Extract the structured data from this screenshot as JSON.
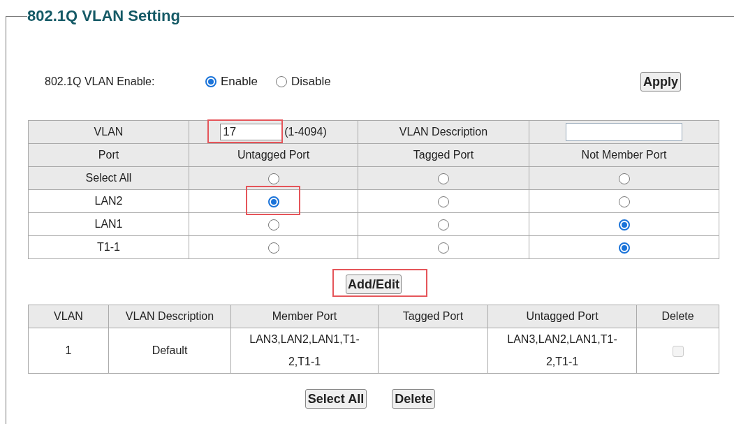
{
  "title": "802.1Q VLAN Setting",
  "enable": {
    "label": "802.1Q VLAN Enable:",
    "options": [
      {
        "label": "Enable",
        "selected": true
      },
      {
        "label": "Disable",
        "selected": false
      }
    ],
    "apply": "Apply"
  },
  "editor": {
    "vlan_label": "VLAN",
    "vlan_value": "17",
    "vlan_highlighted": true,
    "vlan_range": "(1-4094)",
    "description_label": "VLAN Description",
    "columns": [
      "Port",
      "Untagged Port",
      "Tagged Port",
      "Not Member Port"
    ],
    "rows": [
      {
        "port": "Select All",
        "options": [
          {
            "selected": false,
            "highlighted": false
          },
          {
            "selected": false,
            "highlighted": false
          },
          {
            "selected": false,
            "highlighted": false
          }
        ]
      },
      {
        "port": "LAN2",
        "options": [
          {
            "selected": true,
            "highlighted": true
          },
          {
            "selected": false,
            "highlighted": false
          },
          {
            "selected": false,
            "highlighted": false
          }
        ]
      },
      {
        "port": "LAN1",
        "options": [
          {
            "selected": false,
            "highlighted": false
          },
          {
            "selected": false,
            "highlighted": false
          },
          {
            "selected": true,
            "highlighted": false
          }
        ]
      },
      {
        "port": "T1-1",
        "options": [
          {
            "selected": false,
            "highlighted": false
          },
          {
            "selected": false,
            "highlighted": false
          },
          {
            "selected": true,
            "highlighted": false
          }
        ]
      }
    ],
    "add_edit": "Add/Edit",
    "add_edit_highlighted": true
  },
  "table": {
    "columns": [
      "VLAN",
      "VLAN Description",
      "Member Port",
      "Tagged Port",
      "Untagged Port",
      "Delete"
    ],
    "rows": [
      {
        "vlan": "1",
        "description": "Default",
        "member_ports": "LAN3,LAN2,LAN1,T1-2,T1-1",
        "tagged_ports": "",
        "untagged_ports": "LAN3,LAN2,LAN1,T1-2,T1-1",
        "checked": false
      }
    ]
  },
  "buttons": [
    "Select All",
    "Delete"
  ]
}
